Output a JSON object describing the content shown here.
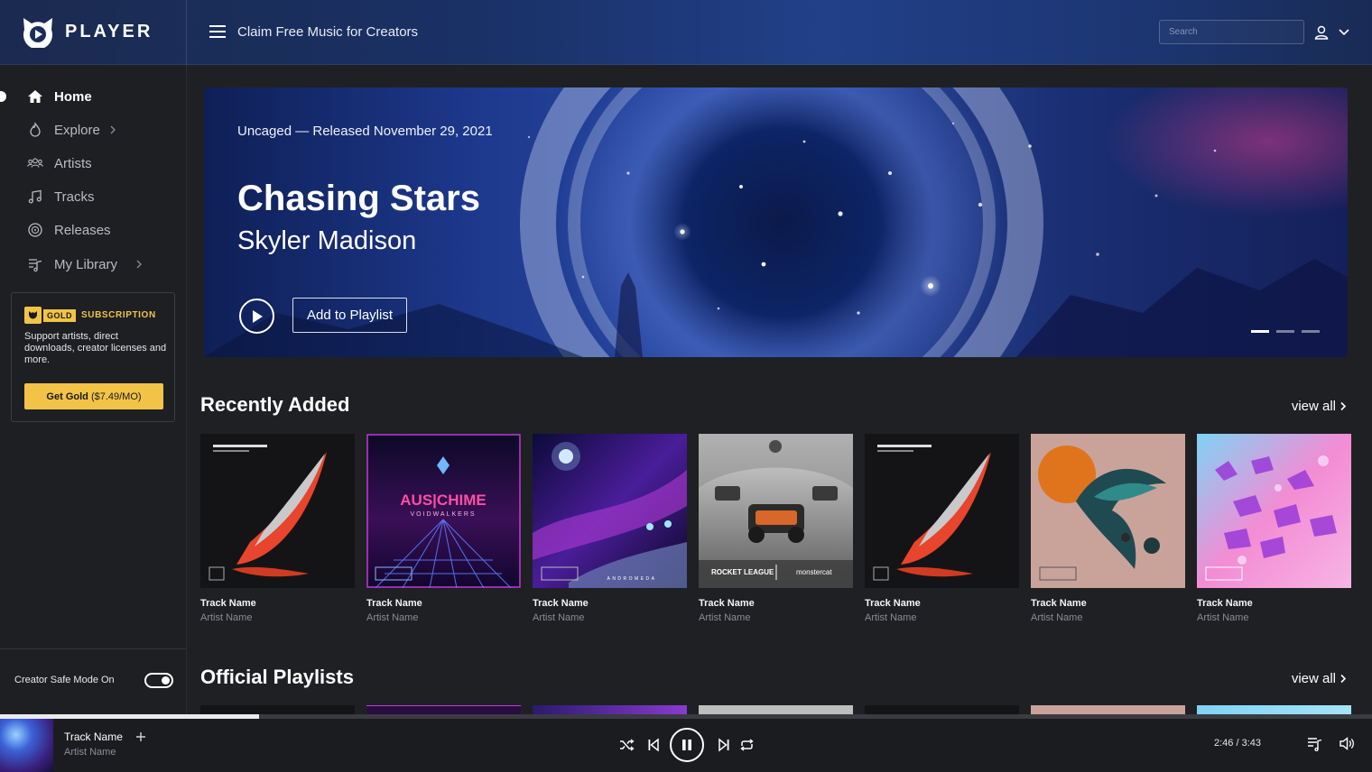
{
  "brand": {
    "name": "PLAYER"
  },
  "header": {
    "title": "Claim Free Music for Creators",
    "search_placeholder": "Search"
  },
  "sidebar": {
    "items": [
      {
        "label": "Home",
        "icon": "home-icon",
        "active": true,
        "has_chevron": false
      },
      {
        "label": "Explore",
        "icon": "flame-icon",
        "active": false,
        "has_chevron": true
      },
      {
        "label": "Artists",
        "icon": "people-icon",
        "active": false,
        "has_chevron": false
      },
      {
        "label": "Tracks",
        "icon": "music-note-icon",
        "active": false,
        "has_chevron": false
      },
      {
        "label": "Releases",
        "icon": "disc-icon",
        "active": false,
        "has_chevron": false
      },
      {
        "label": "My Library",
        "icon": "library-icon",
        "active": false,
        "has_chevron": true
      }
    ],
    "gold": {
      "badge": "GOLD",
      "subscription": "SUBSCRIPTION",
      "description": "Support artists, direct downloads, creator licenses and more.",
      "button_bold": "Get Gold",
      "button_price": "($7.49/MO)"
    },
    "safe_mode": {
      "label": "Creator Safe Mode On",
      "on": true
    }
  },
  "hero": {
    "subtitle": "Uncaged — Released November 29, 2021",
    "title": "Chasing Stars",
    "artist": "Skyler Madison",
    "add_button": "Add to Playlist",
    "slides": 3,
    "active_slide": 0
  },
  "sections": {
    "recently_added": {
      "title": "Recently Added",
      "view_all": "view all",
      "cards": [
        {
          "track": "Track Name",
          "artist": "Artist Name",
          "art": "feather-dark"
        },
        {
          "track": "Track Name",
          "artist": "Artist Name",
          "art": "neon-voidwalkers",
          "cover_title": "AUS|CHIME",
          "cover_sub": "VOIDWALKERS"
        },
        {
          "track": "Track Name",
          "artist": "Artist Name",
          "art": "space-purple",
          "cover_sub": "ANDROMEDA"
        },
        {
          "track": "Track Name",
          "artist": "Artist Name",
          "art": "rocket-league",
          "cover_title": "ROCKET LEAGUE",
          "cover_sub": "monstercat"
        },
        {
          "track": "Track Name",
          "artist": "Artist Name",
          "art": "feather-dark"
        },
        {
          "track": "Track Name",
          "artist": "Artist Name",
          "art": "bird-orange"
        },
        {
          "track": "Track Name",
          "artist": "Artist Name",
          "art": "crystal-pink"
        }
      ]
    },
    "official_playlists": {
      "title": "Official Playlists",
      "view_all": "view all"
    }
  },
  "player": {
    "track": "Track Name",
    "artist": "Artist Name",
    "time_current": "2:46",
    "time_total": "3:43",
    "time_display": "2:46 / 3:43",
    "progress": 0.189
  },
  "colors": {
    "gold": "#f2c347",
    "background": "#1f2024",
    "header": "#1a3166"
  }
}
